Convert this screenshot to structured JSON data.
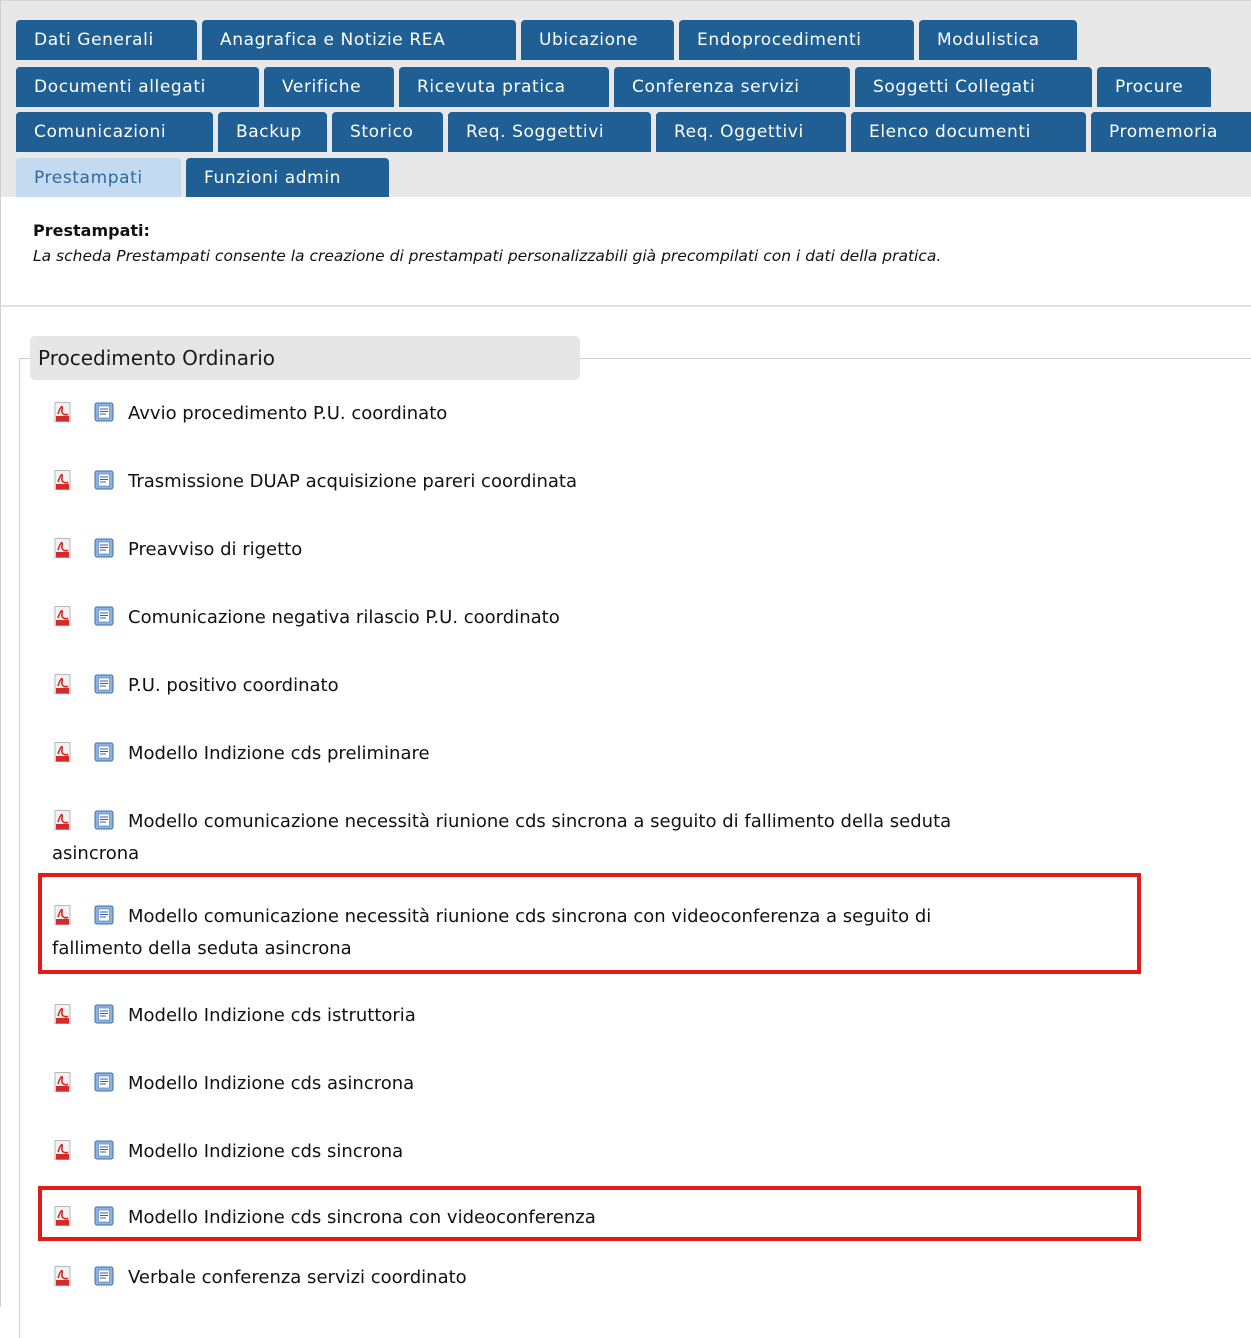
{
  "tabs": {
    "row1": [
      "Dati Generali",
      "Anagrafica e Notizie REA",
      "Ubicazione",
      "Endoprocedimenti",
      "Modulistica"
    ],
    "row2": [
      "Documenti allegati",
      "Verifiche",
      "Ricevuta pratica",
      "Conferenza servizi",
      "Soggetti Collegati",
      "Procure"
    ],
    "row3": [
      "Comunicazioni",
      "Backup",
      "Storico",
      "Req. Soggettivi",
      "Req. Oggettivi",
      "Elenco documenti",
      "Promemoria"
    ],
    "row4": [
      "Prestampati",
      "Funzioni admin"
    ],
    "active": "Prestampati"
  },
  "description": {
    "title": "Prestampati:",
    "text": "La scheda Prestampati consente la creazione di prestampati personalizzabili già precompilati con i dati della pratica."
  },
  "section": {
    "legend": "Procedimento Ordinario",
    "items": [
      {
        "label": "Avvio procedimento P.U. coordinato"
      },
      {
        "label": "Trasmissione DUAP acquisizione pareri coordinata"
      },
      {
        "label": "Preavviso di rigetto"
      },
      {
        "label": "Comunicazione negativa rilascio P.U. coordinato"
      },
      {
        "label": "P.U. positivo coordinato"
      },
      {
        "label": "Modello Indizione cds preliminare"
      },
      {
        "label_line1": "Modello comunicazione necessità riunione cds sincrona a seguito di fallimento della seduta",
        "label_line2": "asincrona"
      },
      {
        "label_line1": "Modello comunicazione necessità riunione cds sincrona con videoconferenza a seguito di",
        "label_line2": "fallimento della seduta asincrona"
      },
      {
        "label": "Modello Indizione cds istruttoria"
      },
      {
        "label": "Modello Indizione cds asincrona"
      },
      {
        "label": "Modello Indizione cds sincrona"
      },
      {
        "label": "Modello Indizione cds sincrona con videoconferenza"
      },
      {
        "label": "Verbale conferenza servizi coordinato"
      }
    ],
    "highlighted_items": [
      "Modello comunicazione necessità riunione cds sincrona con videoconferenza a seguito di fallimento della seduta asincrona",
      "Modello Indizione cds sincrona con videoconferenza"
    ]
  },
  "icons": {
    "pdf": "pdf-icon",
    "doc": "word-doc-icon"
  },
  "colors": {
    "tab_bg": "#1f5f94",
    "tab_active_bg": "#c3daf0",
    "highlight": "#e11a1a"
  }
}
